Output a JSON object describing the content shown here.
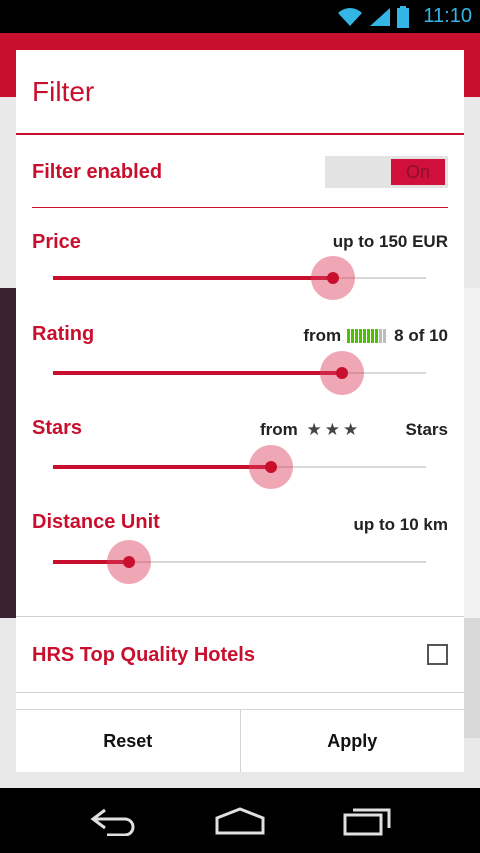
{
  "status_bar": {
    "time": "11:10"
  },
  "dialog": {
    "title": "Filter",
    "filter_enabled": {
      "label": "Filter enabled",
      "toggle_text": "On",
      "enabled": true
    },
    "price": {
      "label": "Price",
      "value": "up to 150 EUR",
      "slider_fraction": 0.75
    },
    "rating": {
      "label": "Rating",
      "prefix": "from",
      "value": "8 of 10",
      "filled_segments": 8,
      "total_segments": 10,
      "slider_fraction": 0.775
    },
    "stars": {
      "label": "Stars",
      "prefix": "from",
      "stars_glyph": "★★★",
      "suffix": "Stars",
      "slider_fraction": 0.585
    },
    "distance": {
      "label": "Distance Unit",
      "value": "up to 10 km",
      "slider_fraction": 0.205
    },
    "top_quality": {
      "label": "HRS Top Quality Hotels",
      "checked": false
    },
    "buttons": {
      "reset": "Reset",
      "apply": "Apply"
    }
  },
  "colors": {
    "accent": "#c8102e",
    "rating_on": "#4fc000",
    "rating_off": "#bdbdbd",
    "status_icons": "#33b5e5"
  }
}
